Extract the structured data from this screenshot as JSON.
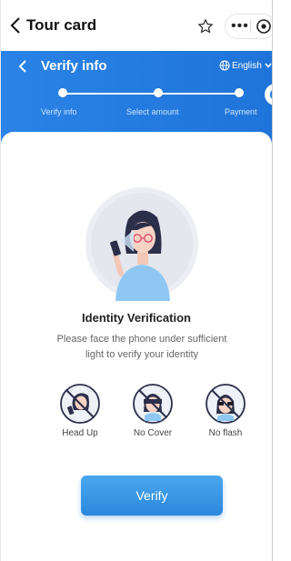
{
  "topbar": {
    "title": "Tour card",
    "back_icon": "chevron-left-icon",
    "favorite_icon": "star-icon",
    "more_icon": "more-icon",
    "target_icon": "target-icon"
  },
  "header": {
    "title": "Verify info",
    "language": "English",
    "steps": [
      {
        "label": "Verify info"
      },
      {
        "label": "Select amount"
      },
      {
        "label": "Payment"
      }
    ],
    "accent": "#2a83e6"
  },
  "content": {
    "title": "Identity Verification",
    "description": "Please face the phone under sufficient light to verify your identity",
    "requirements": [
      {
        "label": "Head Up",
        "icon": "head-up-icon"
      },
      {
        "label": "No Cover",
        "icon": "no-cover-icon"
      },
      {
        "label": "No flash",
        "icon": "no-flash-icon"
      }
    ],
    "verify_button": "Verify"
  }
}
